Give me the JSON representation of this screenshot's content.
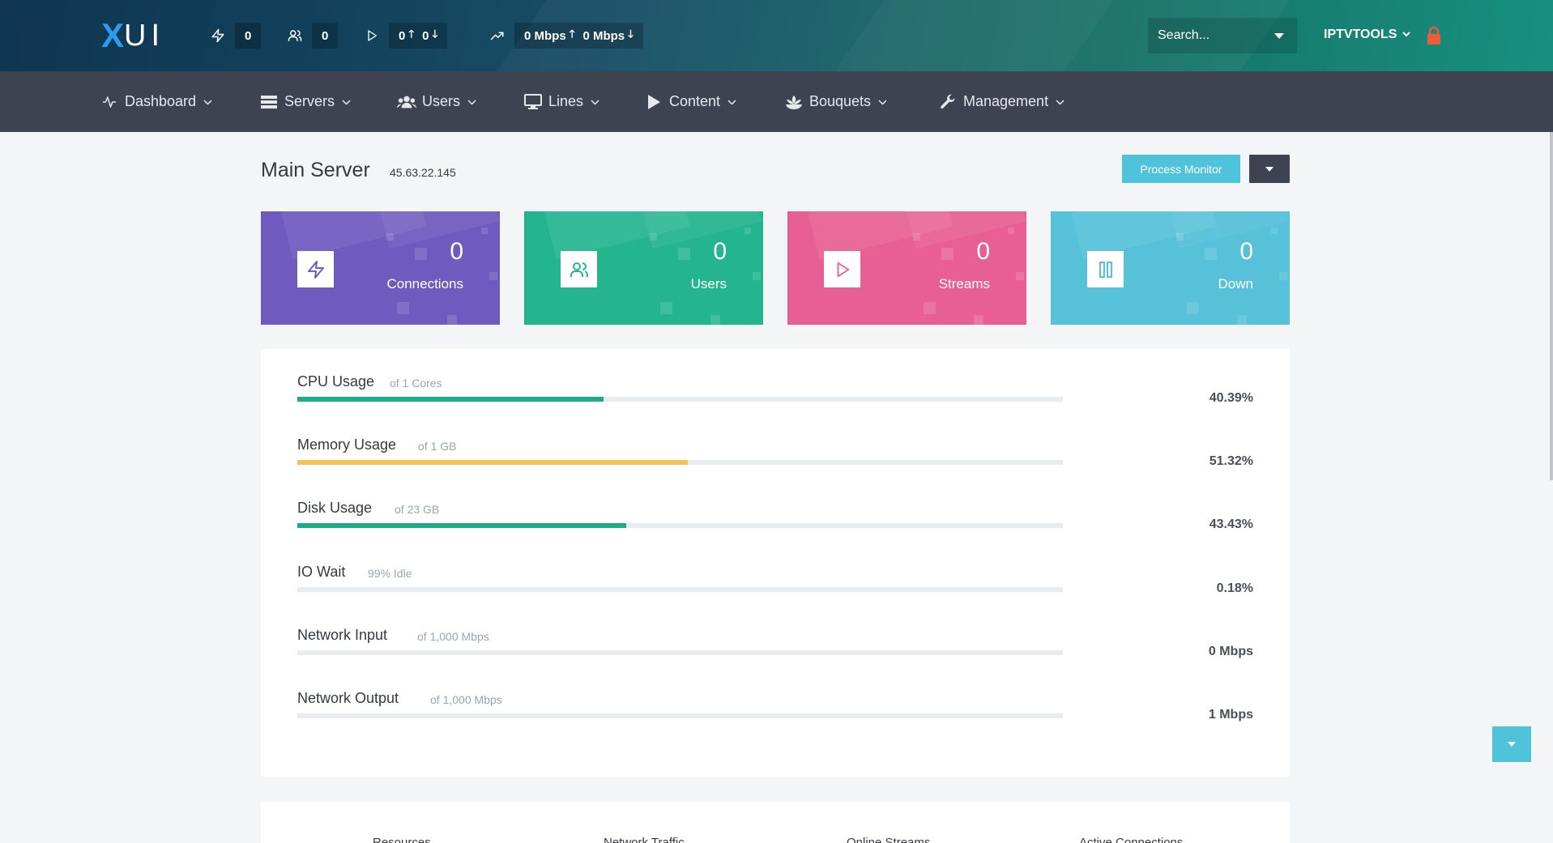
{
  "topbar": {
    "logo_x": "X",
    "logo_ui": "UI",
    "connections_count": "0",
    "users_count": "0",
    "streams_up": "0",
    "streams_down": "0",
    "bandwidth_in": "0 Mbps",
    "bandwidth_out": "0 Mbps",
    "search_placeholder": "Search...",
    "username": "IPTVTOOLS",
    "accent_color": "#2d9cf0",
    "lock_color": "#ef5b34"
  },
  "nav": {
    "items": [
      {
        "label": "Dashboard",
        "icon": "activity-icon"
      },
      {
        "label": "Servers",
        "icon": "server-icon"
      },
      {
        "label": "Users",
        "icon": "users-icon"
      },
      {
        "label": "Lines",
        "icon": "monitor-icon"
      },
      {
        "label": "Content",
        "icon": "play-icon"
      },
      {
        "label": "Bouquets",
        "icon": "flower-icon"
      },
      {
        "label": "Management",
        "icon": "wrench-icon"
      }
    ]
  },
  "page": {
    "title": "Main Server",
    "ip": "45.63.22.145",
    "process_monitor_label": "Process Monitor"
  },
  "cards": [
    {
      "value": "0",
      "label": "Connections",
      "color": "#6f5bc0",
      "icon": "lightning-icon"
    },
    {
      "value": "0",
      "label": "Users",
      "color": "#25b58e",
      "icon": "users-icon"
    },
    {
      "value": "0",
      "label": "Streams",
      "color": "#e86093",
      "icon": "play-icon"
    },
    {
      "value": "0",
      "label": "Down",
      "color": "#56c1d9",
      "icon": "pause-icon"
    }
  ],
  "usage": [
    {
      "name": "CPU Usage",
      "sub": "of 1 Cores",
      "value": "40.39%",
      "fill": 0.4,
      "color": "#1faa8a"
    },
    {
      "name": "Memory Usage",
      "sub": "of 1 GB",
      "value": "51.32%",
      "fill": 0.51,
      "color": "#f4c25a"
    },
    {
      "name": "Disk Usage",
      "sub": "of 23 GB",
      "value": "43.43%",
      "fill": 0.43,
      "color": "#1faa8a"
    },
    {
      "name": "IO Wait",
      "sub": "99% Idle",
      "value": "0.18%",
      "fill": 0.0,
      "color": "#1faa8a"
    },
    {
      "name": "Network Input",
      "sub": "of 1,000 Mbps",
      "value": "0 Mbps",
      "fill": 0.0,
      "color": "#1faa8a"
    },
    {
      "name": "Network Output",
      "sub": "of 1,000 Mbps",
      "value": "1 Mbps",
      "fill": 0.0,
      "color": "#1faa8a"
    }
  ],
  "bottom_panel": {
    "columns": [
      "Resources",
      "Network Traffic",
      "Online Streams",
      "Active Connections"
    ]
  }
}
